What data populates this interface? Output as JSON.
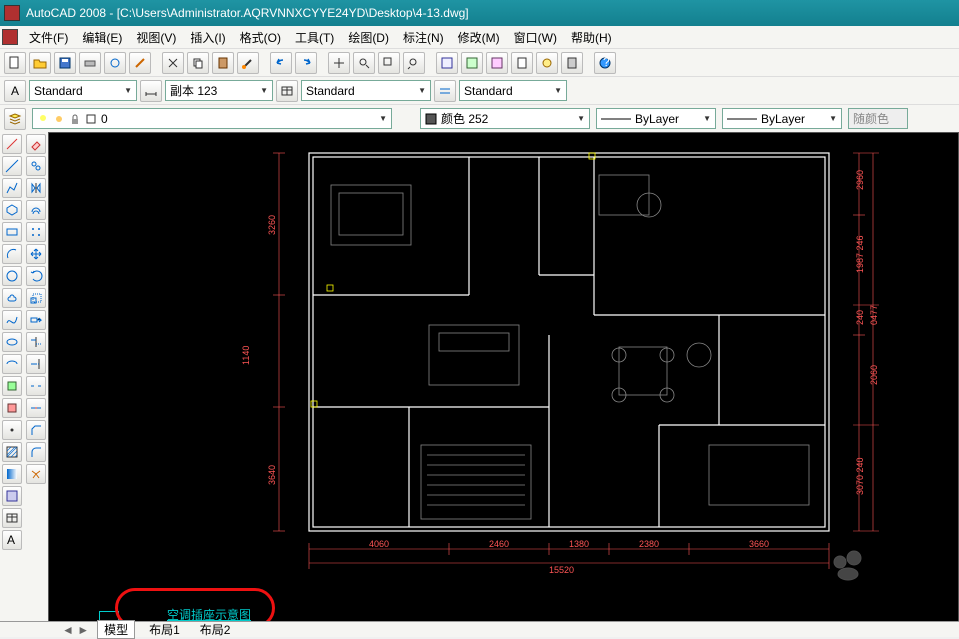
{
  "title": "AutoCAD 2008 - [C:\\Users\\Administrator.AQRVNNXCYYE24YD\\Desktop\\4-13.dwg]",
  "menus": [
    "文件(F)",
    "编辑(E)",
    "视图(V)",
    "插入(I)",
    "格式(O)",
    "工具(T)",
    "绘图(D)",
    "标注(N)",
    "修改(M)",
    "窗口(W)",
    "帮助(H)"
  ],
  "styles": {
    "textstyle": "Standard",
    "dimstyle": "副本 123",
    "tablestyle": "Standard",
    "mlstyle": "Standard"
  },
  "layer": {
    "current": "0"
  },
  "props": {
    "color_label": "颜色 252",
    "linetype": "ByLayer",
    "lineweight": "ByLayer",
    "bycolor": "随颜色"
  },
  "dims": {
    "b1": "4060",
    "b2": "2460",
    "b3": "1380",
    "b4": "2380",
    "b5": "3660",
    "btotal": "15520",
    "r1": "2960",
    "r2": "1987 246",
    "r3": "0477",
    "r4": "240",
    "r5": "2060",
    "r6": "3070 240",
    "l1": "3260",
    "l2": "1140",
    "l3": "3640"
  },
  "layout_link": "空调插座示意图",
  "bottom_tabs": [
    "模型",
    "布局1",
    "布局2"
  ]
}
